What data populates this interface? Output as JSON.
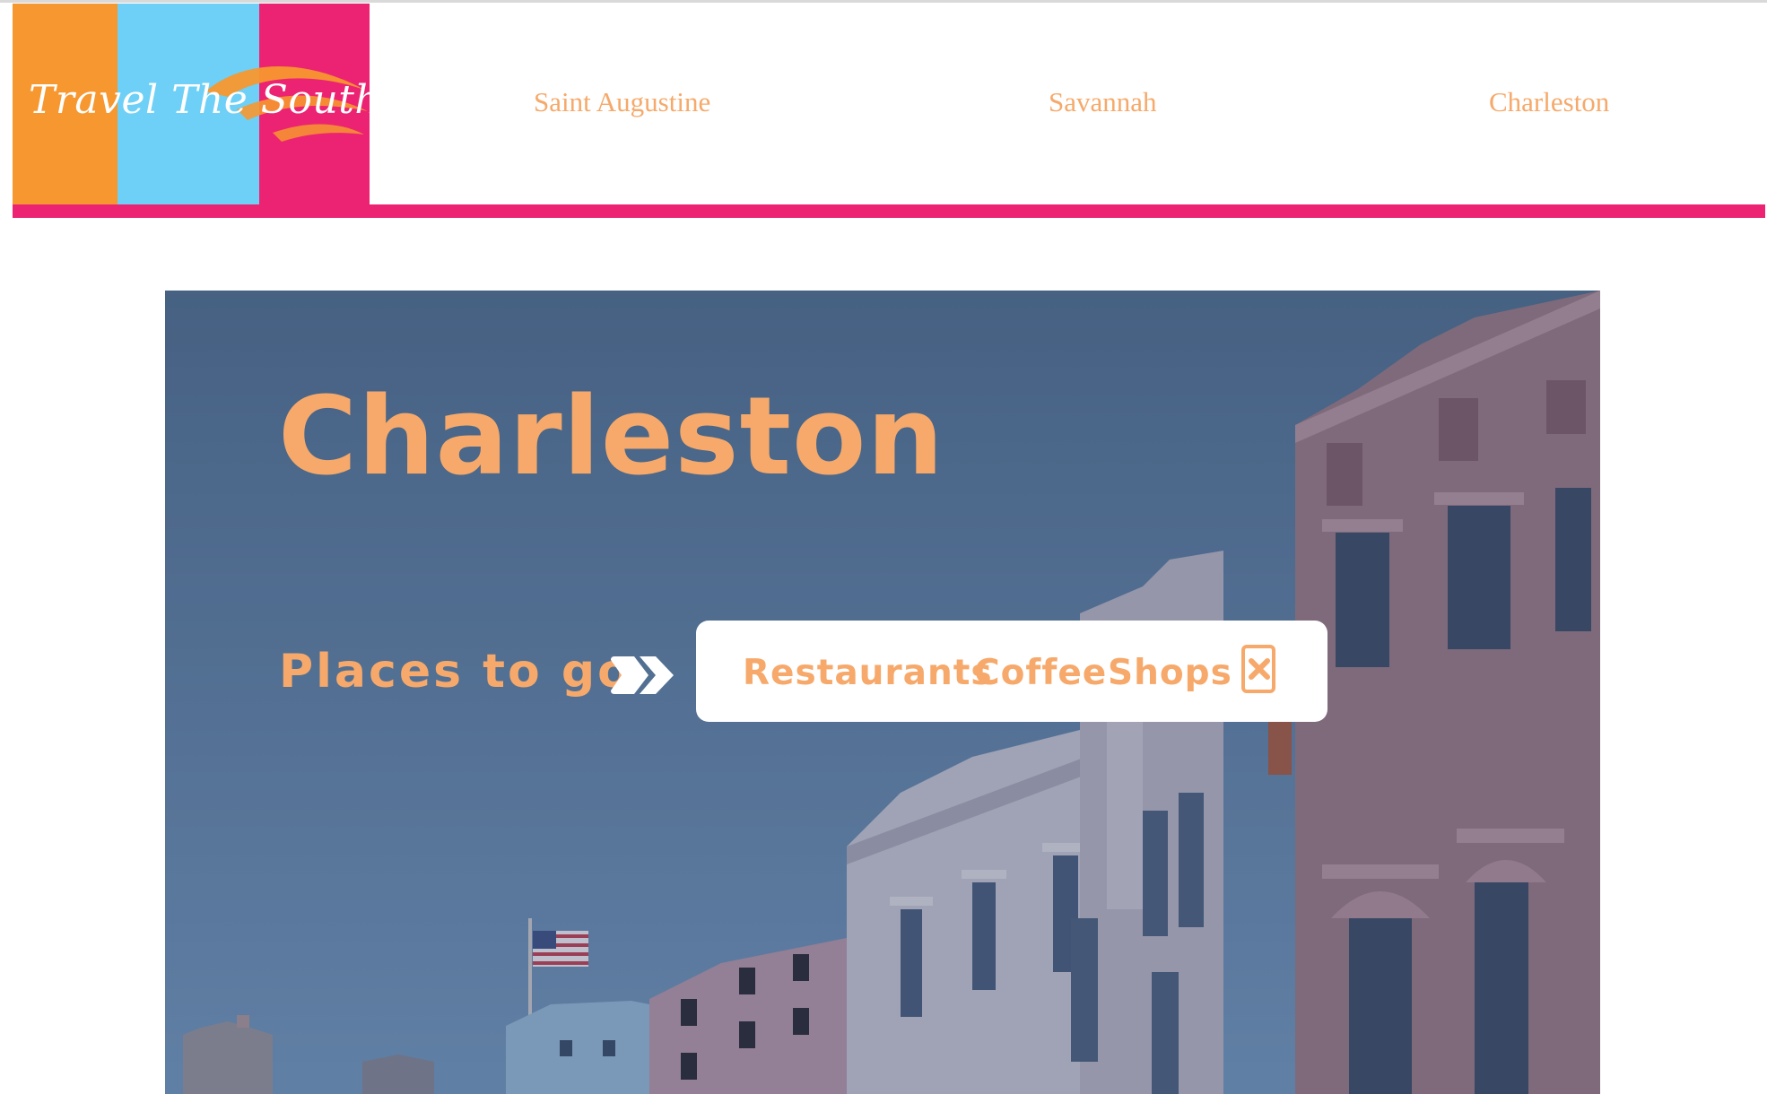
{
  "colors": {
    "orange": "#f7972f",
    "sky_blue": "#6ed0f6",
    "pink": "#ec2372",
    "accent_text": "#f6a96a",
    "white": "#ffffff"
  },
  "header": {
    "logo_text": "Travel The South",
    "nav": [
      {
        "label": "Saint Augustine"
      },
      {
        "label": "Savannah"
      },
      {
        "label": "Charleston"
      }
    ]
  },
  "hero": {
    "title": "Charleston",
    "places_label": "Places to go",
    "arrow_icon": "double-arrow-right-icon",
    "menu": {
      "items": [
        {
          "label": "Restaurants"
        },
        {
          "label": "Coffee"
        },
        {
          "label": "Shops"
        }
      ],
      "close_icon": "close-x-icon"
    },
    "background_image": "charleston-street-buildings-photo"
  }
}
